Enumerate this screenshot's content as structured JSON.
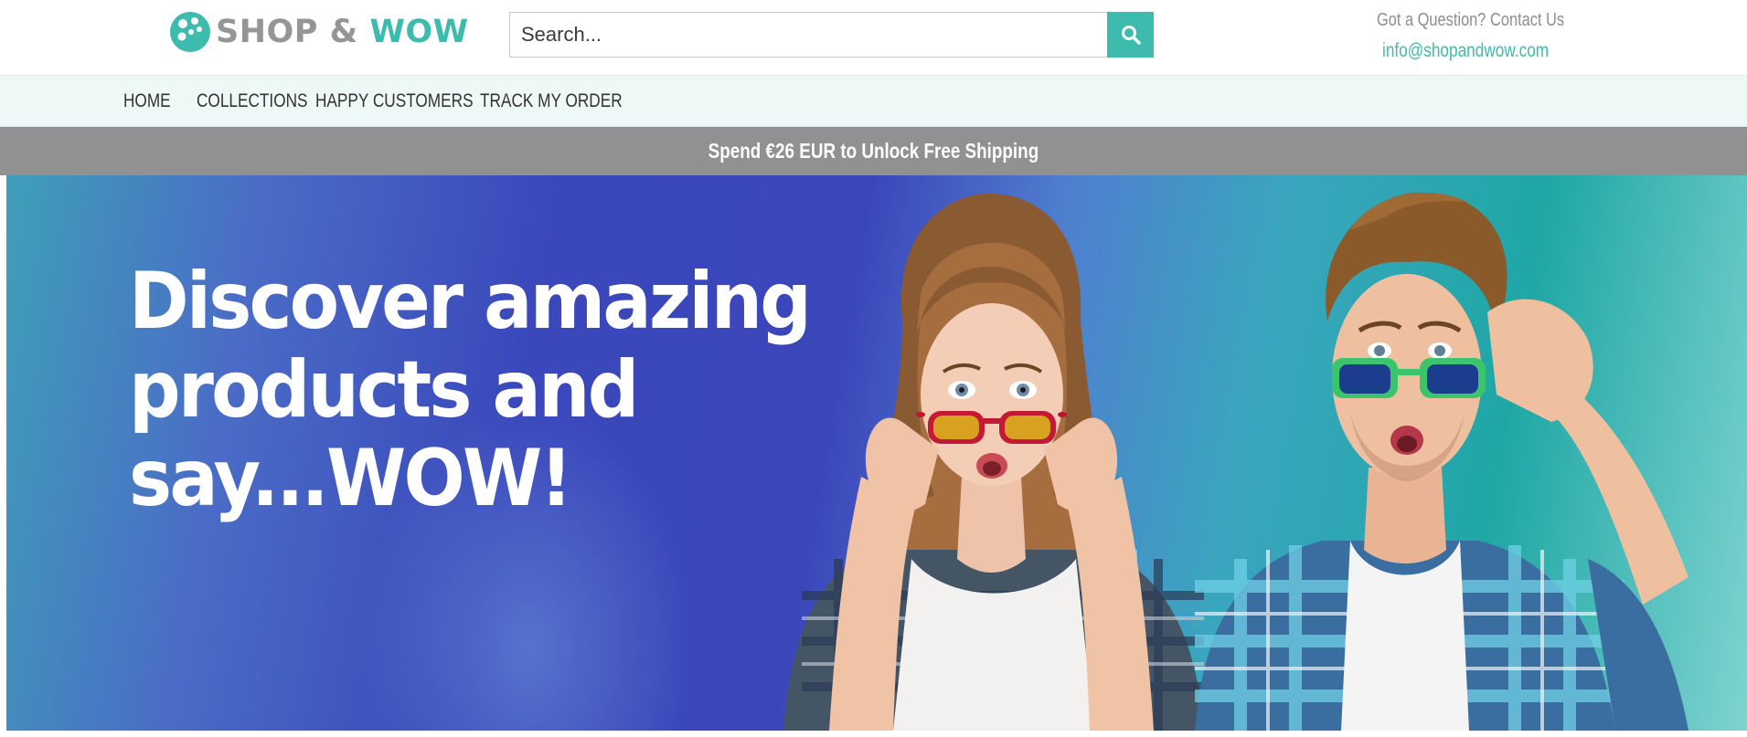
{
  "header": {
    "logo": {
      "text_left": "SHOP &",
      "text_right": "WOW"
    },
    "search": {
      "placeholder": "Search..."
    },
    "contact": {
      "question": "Got a Question? Contact Us",
      "email": "info@shopandwow.com"
    }
  },
  "nav": {
    "items": [
      {
        "label": "HOME"
      },
      {
        "label": "COLLECTIONS"
      },
      {
        "label": "HAPPY CUSTOMERS"
      },
      {
        "label": "TRACK MY ORDER"
      }
    ]
  },
  "announcement": {
    "text": "Spend €26 EUR to Unlock Free Shipping"
  },
  "hero": {
    "lines": [
      "Discover amazing",
      "products and",
      "say...WOW!"
    ]
  },
  "colors": {
    "brand_teal": "#3dbcad",
    "brand_grey": "#959595",
    "nav_bg": "#eef8f7",
    "announcement_bg": "#919191",
    "hero_blue": "#3b46b9"
  },
  "icons": {
    "logo": "logo-dots-icon",
    "search": "search-icon",
    "email": "envelope-icon"
  }
}
